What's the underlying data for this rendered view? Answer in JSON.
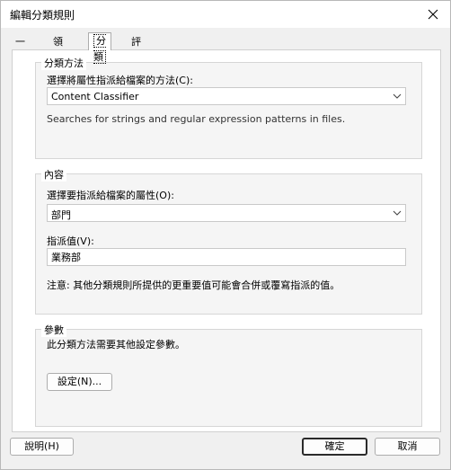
{
  "window": {
    "title": "編輯分類規則"
  },
  "icons": {
    "close": "close-icon",
    "dropdown": "chevron-down-icon"
  },
  "tabs": [
    {
      "label": "一般"
    },
    {
      "label": "領域"
    },
    {
      "label": "分類"
    },
    {
      "label": "評估類型"
    }
  ],
  "active_tab": "分類",
  "classification_method": {
    "legend": "分類方法",
    "prompt": "選擇將屬性指派給檔案的方法(C):",
    "selected": "Content Classifier",
    "description": "Searches for strings and regular expression patterns in files."
  },
  "content": {
    "legend": "內容",
    "property_prompt": "選擇要指派給檔案的屬性(O):",
    "property_selected": "部門",
    "value_label": "指派值(V):",
    "value": "業務部",
    "note": "注意: 其他分類規則所提供的更重要值可能會合併或覆寫指派的值。"
  },
  "parameters": {
    "legend": "參數",
    "text": "此分類方法需要其他設定參數。",
    "configure_button": "設定(N)..."
  },
  "footer": {
    "help_button": "說明(H)",
    "ok_button": "確定",
    "cancel_button": "取消"
  }
}
